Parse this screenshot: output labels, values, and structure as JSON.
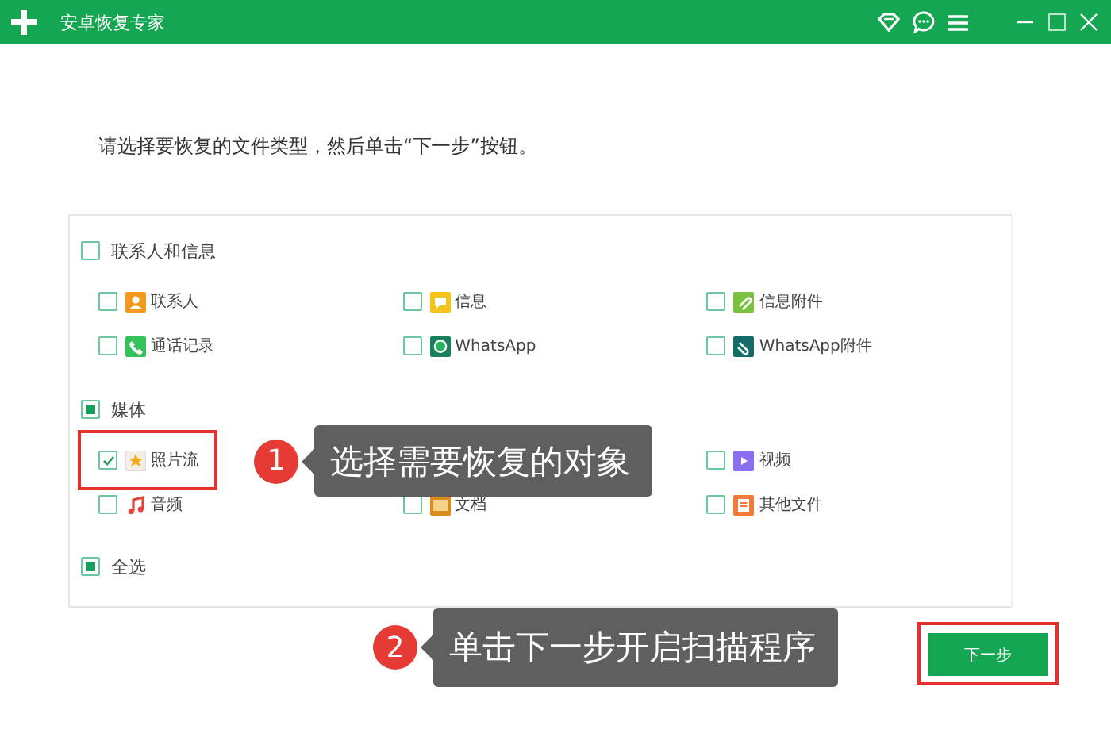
{
  "window": {
    "title": "安卓恢复专家"
  },
  "instruction": "请选择要恢复的文件类型，然后单击“下一步”按钮。",
  "groups": [
    {
      "label": "联系人和信息",
      "checked": false,
      "partial": false,
      "rows": [
        [
          {
            "kind": "item",
            "label": "联系人",
            "checked": false,
            "highlighted": false
          },
          {
            "kind": "item",
            "label": "信息",
            "checked": false,
            "highlighted": false
          },
          {
            "kind": "item",
            "label": "信息附件",
            "checked": false,
            "highlighted": false
          }
        ],
        [
          {
            "kind": "item",
            "label": "通话记录",
            "checked": false,
            "highlighted": false
          },
          {
            "kind": "item",
            "label": "WhatsApp",
            "checked": false,
            "highlighted": false
          },
          {
            "kind": "item",
            "label": "WhatsApp附件",
            "checked": false,
            "highlighted": false
          }
        ]
      ]
    },
    {
      "label": "媒体",
      "checked": false,
      "partial": true,
      "rows": [
        [
          {
            "kind": "item",
            "label": "照片流",
            "checked": true,
            "highlighted": true
          },
          {
            "kind": "covered"
          },
          {
            "kind": "item",
            "label": "视频",
            "checked": false,
            "highlighted": false
          }
        ],
        [
          {
            "kind": "item",
            "label": "音频",
            "checked": false,
            "highlighted": false
          },
          {
            "kind": "item",
            "label": "文档",
            "checked": false,
            "highlighted": false
          },
          {
            "kind": "item",
            "label": "其他文件",
            "checked": false,
            "highlighted": false
          }
        ]
      ]
    },
    {
      "label": "全选",
      "checked": false,
      "partial": true
    }
  ],
  "next_button": {
    "label": "下一步",
    "highlighted": true
  },
  "callouts": [
    {
      "number": "1",
      "text": "选择需要恢复的对象"
    },
    {
      "number": "2",
      "text": "单击下一步开启扫描程序"
    }
  ]
}
